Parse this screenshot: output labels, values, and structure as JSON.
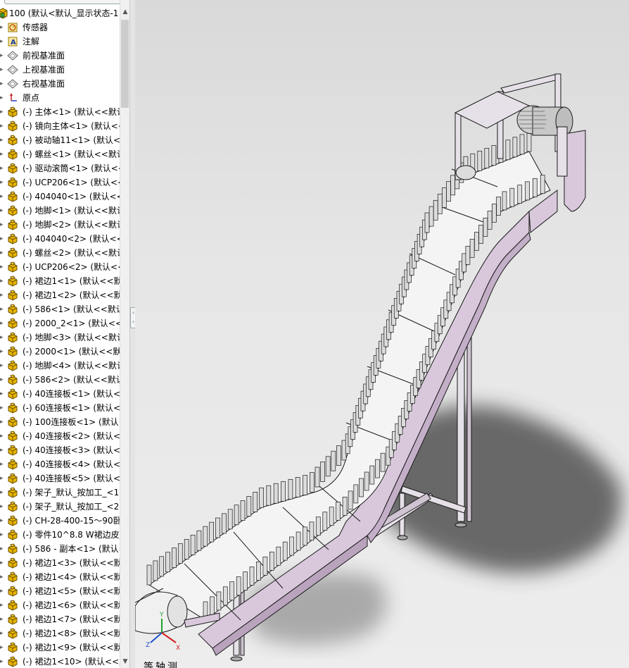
{
  "tree": {
    "items": [
      {
        "label": "100 (默认<默认_显示状态-1",
        "icon": "assembly-icon",
        "suppressed": false,
        "level": 0
      },
      {
        "label": "传感器",
        "icon": "sensors-icon",
        "suppressed": false,
        "level": 1
      },
      {
        "label": "注解",
        "icon": "annotations-icon",
        "suppressed": false,
        "level": 1
      },
      {
        "label": "前视基准面",
        "icon": "plane-icon",
        "suppressed": false,
        "level": 1
      },
      {
        "label": "上视基准面",
        "icon": "plane-icon",
        "suppressed": false,
        "level": 1
      },
      {
        "label": "右视基准面",
        "icon": "plane-icon",
        "suppressed": false,
        "level": 1
      },
      {
        "label": "原点",
        "icon": "origin-icon",
        "suppressed": false,
        "level": 1
      },
      {
        "label": "主体<1> (默认<<默认",
        "icon": "part-icon",
        "suppressed": true,
        "level": 1
      },
      {
        "label": "镜向主体<1> (默认<<默",
        "icon": "part-icon",
        "suppressed": true,
        "level": 1
      },
      {
        "label": "被动轴11<1> (默认<<",
        "icon": "part-icon",
        "suppressed": true,
        "level": 1
      },
      {
        "label": "螺丝<1> (默认<<默认",
        "icon": "part-icon",
        "suppressed": true,
        "level": 1
      },
      {
        "label": "驱动滚筒<1> (默认<<",
        "icon": "part-icon",
        "suppressed": true,
        "level": 1
      },
      {
        "label": "UCP206<1> (默认<<",
        "icon": "part-icon",
        "suppressed": true,
        "level": 1
      },
      {
        "label": "404040<1> (默认<<默",
        "icon": "part-icon",
        "suppressed": true,
        "level": 1
      },
      {
        "label": "地脚<1> (默认<<默认",
        "icon": "part-icon",
        "suppressed": true,
        "level": 1
      },
      {
        "label": "地脚<2> (默认<<默认",
        "icon": "part-icon",
        "suppressed": true,
        "level": 1
      },
      {
        "label": "404040<2> (默认<<默",
        "icon": "part-icon",
        "suppressed": true,
        "level": 1
      },
      {
        "label": "螺丝<2> (默认<<默认",
        "icon": "part-icon",
        "suppressed": true,
        "level": 1
      },
      {
        "label": "UCP206<2> (默认<<",
        "icon": "part-icon",
        "suppressed": true,
        "level": 1
      },
      {
        "label": "裙边1<1> (默认<<默",
        "icon": "part-icon",
        "suppressed": true,
        "level": 1
      },
      {
        "label": "裙边1<2> (默认<<默",
        "icon": "part-icon",
        "suppressed": true,
        "level": 1
      },
      {
        "label": "586<1> (默认<<默认",
        "icon": "part-icon",
        "suppressed": true,
        "level": 1
      },
      {
        "label": "2000_2<1> (默认<<默",
        "icon": "part-icon",
        "suppressed": true,
        "level": 1
      },
      {
        "label": "地脚<3> (默认<<默认",
        "icon": "part-icon",
        "suppressed": true,
        "level": 1
      },
      {
        "label": "2000<1> (默认<<默认",
        "icon": "part-icon",
        "suppressed": true,
        "level": 1
      },
      {
        "label": "地脚<4> (默认<<默认",
        "icon": "part-icon",
        "suppressed": true,
        "level": 1
      },
      {
        "label": "586<2> (默认<<默认",
        "icon": "part-icon",
        "suppressed": true,
        "level": 1
      },
      {
        "label": "40连接板<1> (默认<",
        "icon": "part-icon",
        "suppressed": true,
        "level": 1
      },
      {
        "label": "60连接板<1> (默认<",
        "icon": "part-icon",
        "suppressed": true,
        "level": 1
      },
      {
        "label": "100连接板<1> (默认<",
        "icon": "part-icon",
        "suppressed": true,
        "level": 1
      },
      {
        "label": "40连接板<2> (默认<",
        "icon": "part-icon",
        "suppressed": true,
        "level": 1
      },
      {
        "label": "40连接板<3> (默认<",
        "icon": "part-icon",
        "suppressed": true,
        "level": 1
      },
      {
        "label": "40连接板<4> (默认<",
        "icon": "part-icon",
        "suppressed": true,
        "level": 1
      },
      {
        "label": "40连接板<5> (默认<",
        "icon": "part-icon",
        "suppressed": true,
        "level": 1
      },
      {
        "label": "架子_默认_按加工_<1>",
        "icon": "part-icon",
        "suppressed": true,
        "level": 1
      },
      {
        "label": "架子_默认_按加工_<2>",
        "icon": "part-icon",
        "suppressed": true,
        "level": 1
      },
      {
        "label": "CH-28-400-15～90卧",
        "icon": "part-icon",
        "suppressed": true,
        "level": 1
      },
      {
        "label": "零件10^8.8 W裙边皮",
        "icon": "part-icon",
        "suppressed": true,
        "level": 1
      },
      {
        "label": "586 - 副本<1> (默认<",
        "icon": "part-icon",
        "suppressed": true,
        "level": 1
      },
      {
        "label": "裙边1<3> (默认<<默",
        "icon": "part-icon",
        "suppressed": true,
        "level": 1
      },
      {
        "label": "裙边1<4> (默认<<默",
        "icon": "part-icon",
        "suppressed": true,
        "level": 1
      },
      {
        "label": "裙边1<5> (默认<<默",
        "icon": "part-icon",
        "suppressed": true,
        "level": 1
      },
      {
        "label": "裙边1<6> (默认<<默",
        "icon": "part-icon",
        "suppressed": true,
        "level": 1
      },
      {
        "label": "裙边1<7> (默认<<默",
        "icon": "part-icon",
        "suppressed": true,
        "level": 1
      },
      {
        "label": "裙边1<8> (默认<<默",
        "icon": "part-icon",
        "suppressed": true,
        "level": 1
      },
      {
        "label": "裙边1<9> (默认<<默",
        "icon": "part-icon",
        "suppressed": true,
        "level": 1
      },
      {
        "label": "裙边1<10> (默认<<默",
        "icon": "part-icon",
        "suppressed": true,
        "level": 1
      }
    ],
    "suppressed_prefix": "(-) "
  },
  "viewport": {
    "view_label": "等轴测",
    "model": "skirt-belt-conveyor-model",
    "colors": {
      "frame": "#d9c8dc",
      "frame_shadow": "#b9a3bd",
      "belt": "#f4f4f4",
      "cleat": "#dcdcdc",
      "edge": "#1a1a1a",
      "shadow": "#4a4a4a"
    }
  },
  "colors": {
    "tree_bg": "#ffffff",
    "viewport_bg": "#e4e4e4",
    "part_icon": "#e8b400"
  }
}
